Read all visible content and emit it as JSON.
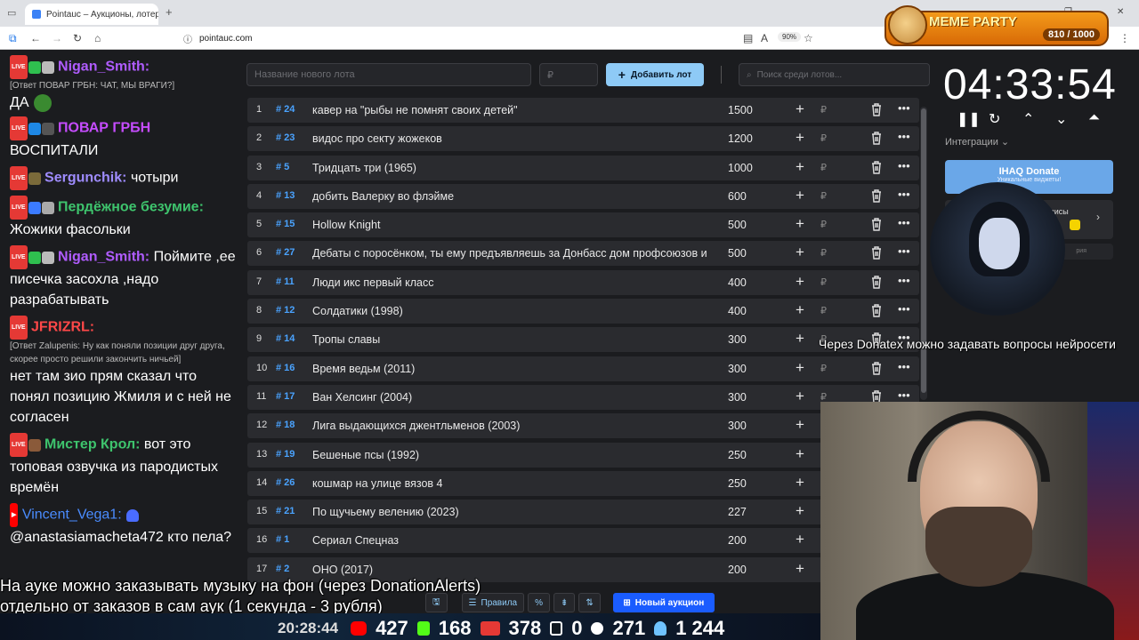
{
  "browser": {
    "tab_title": "Pointauc – Аукционы, лотереи",
    "url": "pointauc.com",
    "zoom": "90%"
  },
  "meme": {
    "title": "MEME PARTY",
    "counter": "810 / 1000"
  },
  "chat": [
    {
      "nick": "Nigan_Smith:",
      "color": "#b05cff",
      "reply": "[Ответ ПОВАР ГРБН: ЧАТ, МЫ ВРАГИ?]",
      "text": "ДА"
    },
    {
      "nick": "ПОВАР ГРБН",
      "color": "#c64cff",
      "text": "ВОСПИТАЛИ"
    },
    {
      "nick": "Sergunchik:",
      "color": "#9f8cff",
      "text": "чотыри"
    },
    {
      "nick": "Пердёжное безумие:",
      "color": "#3ec46d",
      "text": "Жожики фасольки"
    },
    {
      "nick": "Nigan_Smith:",
      "color": "#b05cff",
      "text": "Поймите ,ее писечка засохла ,надо разрабатывать"
    },
    {
      "nick": "JFRIZRL:",
      "color": "#ff4848",
      "reply": "[Ответ Zalupenis: Ну как поняли позиции друг друга, скорее просто решили закончить ничьей]",
      "text": "нет там зио прям сказал что понял позицию Жмиля и с ней не согласен"
    },
    {
      "nick": "Мистер Крол:",
      "color": "#3ec46d",
      "text": "вот это топовая озвучка из пародистых времён"
    },
    {
      "nick": "Vincent_Vega1:",
      "color": "#4a8cff",
      "text": "@anastasiamacheta472 кто пела?"
    }
  ],
  "auction": {
    "new_lot_placeholder": "Название нового лота",
    "amount_placeholder": "₽",
    "add_button": "Добавить лот",
    "search_placeholder": "Поиск среди лотов...",
    "lots": [
      {
        "n": "1",
        "id": "# 24",
        "name": "кавер на \"рыбы не помнят своих детей\"",
        "amount": "1500"
      },
      {
        "n": "2",
        "id": "# 23",
        "name": "видос про секту жожеков",
        "amount": "1200"
      },
      {
        "n": "3",
        "id": "# 5",
        "name": "Тридцать три (1965)",
        "amount": "1000"
      },
      {
        "n": "4",
        "id": "# 13",
        "name": "добить Валерку во флэйме",
        "amount": "600"
      },
      {
        "n": "5",
        "id": "# 15",
        "name": "Hollow Knight",
        "amount": "500"
      },
      {
        "n": "6",
        "id": "# 27",
        "name": "Дебаты с поросёнком, ты ему предъявляешь за Донбасс дом профсоюзов и",
        "amount": "500"
      },
      {
        "n": "7",
        "id": "# 11",
        "name": "Люди икс первый класс",
        "amount": "400"
      },
      {
        "n": "8",
        "id": "# 12",
        "name": "Солдатики (1998)",
        "amount": "400"
      },
      {
        "n": "9",
        "id": "# 14",
        "name": "Тропы славы",
        "amount": "300"
      },
      {
        "n": "10",
        "id": "# 16",
        "name": "Время ведьм (2011)",
        "amount": "300"
      },
      {
        "n": "11",
        "id": "# 17",
        "name": "Ван Хелсинг (2004)",
        "amount": "300"
      },
      {
        "n": "12",
        "id": "# 18",
        "name": "Лига выдающихся джентльменов (2003)",
        "amount": "300"
      },
      {
        "n": "13",
        "id": "# 19",
        "name": "Бешеные псы (1992)",
        "amount": "250"
      },
      {
        "n": "14",
        "id": "# 26",
        "name": "кошмар на улице вязов 4",
        "amount": "250"
      },
      {
        "n": "15",
        "id": "# 21",
        "name": "По щучьему велению (2023)",
        "amount": "227"
      },
      {
        "n": "16",
        "id": "# 1",
        "name": "Сериал Спецназ",
        "amount": "200"
      },
      {
        "n": "17",
        "id": "# 2",
        "name": "ОНО (2017)",
        "amount": "200"
      }
    ],
    "footer": {
      "rules": "Правила",
      "new_auction": "Новый аукцион"
    }
  },
  "timer": {
    "value": "04:33:54",
    "integrations": "Интеграции",
    "donate_title": "IHAQ Donate",
    "donate_sub": "Уникальные виджеты!",
    "panel_text": "висы",
    "panel2_text": "рия"
  },
  "overlays": {
    "donatex": "Через Donatex можно задавать вопросы нейросети",
    "music_line1": "На ауке можно заказывать музыку на фон (через DonationAlerts)",
    "music_line2": "отдельно от заказов в сам аук (1 секунда - 3 рубля)"
  },
  "stats": {
    "time": "20:28:44",
    "youtube": "427",
    "kick": "168",
    "live": "378",
    "rutube": "0",
    "vk": "271",
    "total": "1 244"
  }
}
